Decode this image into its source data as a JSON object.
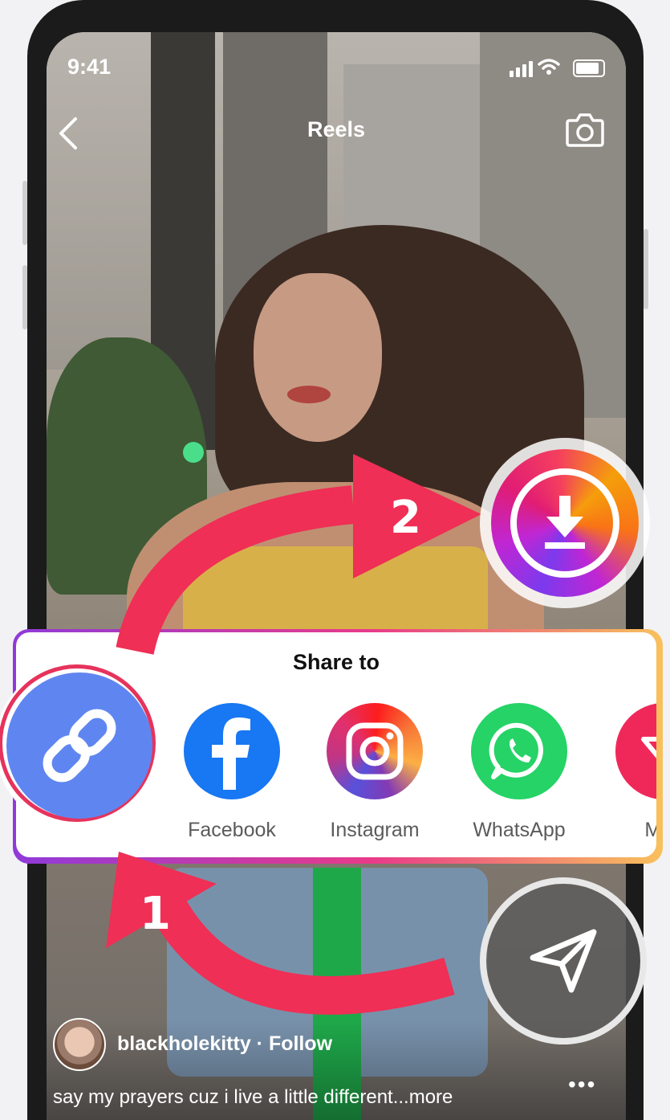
{
  "status_bar": {
    "time": "9:41"
  },
  "header": {
    "title": "Reels"
  },
  "share_sheet": {
    "title": "Share to",
    "apps": [
      {
        "label": "Facebook",
        "icon": "facebook-icon",
        "color": "#1877f2"
      },
      {
        "label": "Instagram",
        "icon": "instagram-icon",
        "color": "#e1306c"
      },
      {
        "label": "WhatsApp",
        "icon": "whatsapp-icon",
        "color": "#25d366"
      },
      {
        "label": "Mes",
        "icon": "messenger-icon",
        "color": "#f0285a"
      }
    ]
  },
  "steps": {
    "one": "1",
    "two": "2"
  },
  "post": {
    "username": "blackholekitty · Follow",
    "caption": "say my prayers cuz i live a little different...more"
  },
  "colors": {
    "arrow": "#ef2f55",
    "link": "#5f86f0",
    "ring": "#e6335c"
  }
}
